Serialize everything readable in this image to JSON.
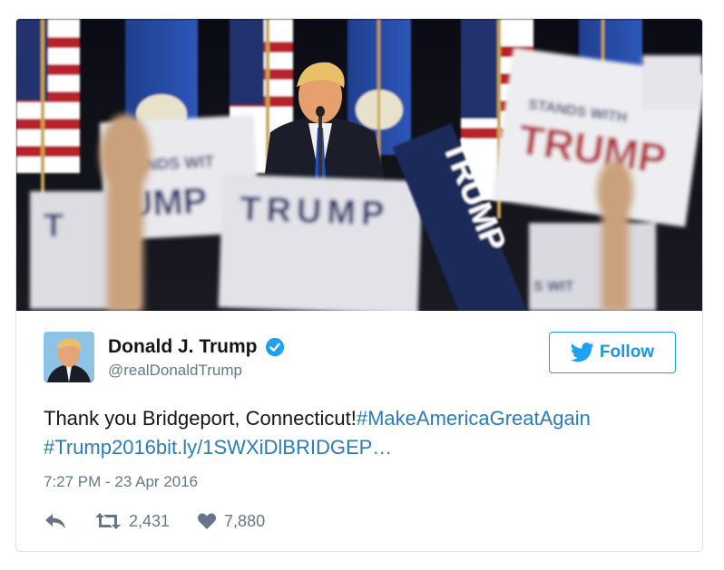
{
  "tweet": {
    "photo_sign_texts": [
      "TRUMP",
      "TRUMP",
      "T UMP",
      "TRUMP",
      "STANDS WITH",
      "ANDS WIT",
      "S WIT"
    ],
    "display_name": "Donald J. Trump",
    "handle": "@realDonaldTrump",
    "follow_label": "Follow",
    "text_plain": "Thank you Bridgeport, Connecticut!",
    "hashtag_1": "#MakeAmericaGreatAgain",
    "hashtag_2": "#Trump2016",
    "link": "bit.ly/1SWXiDlBRIDGEP…",
    "timestamp": "7:27 PM - 23 Apr 2016",
    "retweet_count": "2,431",
    "like_count": "7,880"
  },
  "colors": {
    "accent": "#1da1f2",
    "link": "#2b7bb9",
    "muted": "#657786",
    "text": "#14171a",
    "border": "#dcdfe3"
  },
  "icons": {
    "follow": "twitter-bird-icon",
    "verified": "verified-badge-icon",
    "reply": "reply-icon",
    "retweet": "retweet-icon",
    "like": "heart-icon"
  }
}
